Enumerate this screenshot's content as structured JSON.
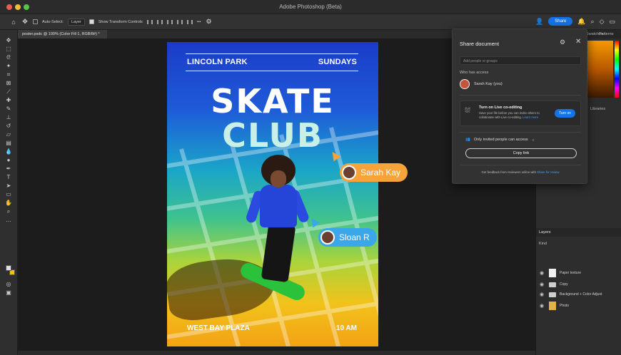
{
  "app": {
    "title": "Adobe Photoshop (Beta)"
  },
  "options_bar": {
    "auto_select_label": "Auto-Select:",
    "auto_select_value": "Layer",
    "show_transform_label": "Show Transform Controls",
    "more_label": "•••",
    "share_label": "Share"
  },
  "document": {
    "tab_label": "poster.psdc @ 100% (Color Fill 1, RGB/8#) *"
  },
  "poster": {
    "location": "LINCOLN PARK",
    "day": "SUNDAYS",
    "title_line1": "SKATE",
    "title_line2": "CLUB",
    "venue": "WEST BAY PLAZA",
    "time": "10 AM"
  },
  "collaborators": [
    {
      "name": "Sarah Kay",
      "color": "#f5a33a"
    },
    {
      "name": "Sloan R",
      "color": "#3aa7ea"
    }
  ],
  "share_dialog": {
    "title": "Share document",
    "input_placeholder": "Add people or groups",
    "who_has_access": "Who has access",
    "owner": "Sarah Kay (you)",
    "live_title": "Turn on Live co-editing",
    "live_desc": "Save your file before you can invite others to collaborate with Live co-editing.",
    "live_learn": "Learn more",
    "turn_on_label": "Turn on",
    "access_label": "Only invited people can access",
    "copy_link_label": "Copy link",
    "feedback_text": "Get feedback from reviewers online with",
    "feedback_link": "Share for review"
  },
  "right_panel": {
    "tab_swatches": "Swatches",
    "tab_patterns": "Patterns",
    "libraries_label": "Libraries",
    "layers_tab": "Layers",
    "kind_label": "Kind",
    "layers": [
      {
        "name": "Paper texture",
        "type": "thumb"
      },
      {
        "name": "Copy",
        "type": "folder"
      },
      {
        "name": "Background + Color Adjust",
        "type": "folder"
      },
      {
        "name": "Photo",
        "type": "photo"
      }
    ]
  },
  "colors": {
    "accent": "#1473e6",
    "foreground_swatch": "#e0e0e0",
    "background_swatch": "#f1c20d"
  }
}
